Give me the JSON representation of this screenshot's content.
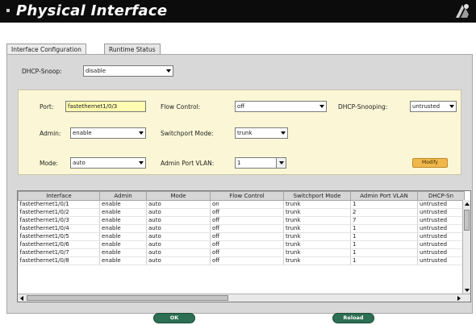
{
  "window": {
    "title": "Physical Interface"
  },
  "tabs": [
    {
      "label": "Interface Configuration",
      "active": true
    },
    {
      "label": "Runtime Status",
      "active": false
    }
  ],
  "dhcp_snoop": {
    "label": "DHCP-Snoop:",
    "value": "disable"
  },
  "config": {
    "port": {
      "label": "Port:",
      "value": "fastethernet1/0/3"
    },
    "flow_control": {
      "label": "Flow Control:",
      "value": "off"
    },
    "dhcp_snooping": {
      "label": "DHCP-Snooping:",
      "value": "untrusted"
    },
    "admin": {
      "label": "Admin:",
      "value": "enable"
    },
    "switchport_mode": {
      "label": "Switchport Mode:",
      "value": "trunk"
    },
    "mode": {
      "label": "Mode:",
      "value": "auto"
    },
    "admin_port_vlan": {
      "label": "Admin Port VLAN:",
      "value": "1"
    },
    "modify_label": "Modify"
  },
  "table": {
    "columns": [
      "Interface",
      "Admin",
      "Mode",
      "Flow Control",
      "Switchport Mode",
      "Admin Port VLAN",
      "DHCP-Sn"
    ],
    "rows": [
      [
        "fastethernet1/0/1",
        "enable",
        "auto",
        "on",
        "trunk",
        "1",
        "untrusted"
      ],
      [
        "fastethernet1/0/2",
        "enable",
        "auto",
        "off",
        "trunk",
        "2",
        "untrusted"
      ],
      [
        "fastethernet1/0/3",
        "enable",
        "auto",
        "off",
        "trunk",
        "7",
        "untrusted"
      ],
      [
        "fastethernet1/0/4",
        "enable",
        "auto",
        "off",
        "trunk",
        "1",
        "untrusted"
      ],
      [
        "fastethernet1/0/5",
        "enable",
        "auto",
        "off",
        "trunk",
        "1",
        "untrusted"
      ],
      [
        "fastethernet1/0/6",
        "enable",
        "auto",
        "off",
        "trunk",
        "1",
        "untrusted"
      ],
      [
        "fastethernet1/0/7",
        "enable",
        "auto",
        "off",
        "trunk",
        "1",
        "untrusted"
      ],
      [
        "fastethernet1/0/8",
        "enable",
        "auto",
        "off",
        "trunk",
        "1",
        "untrusted"
      ]
    ]
  },
  "buttons": {
    "ok": "OK",
    "reload": "Reload"
  },
  "colors": {
    "title_bar": "#0c0c0c",
    "panel": "#d8d8d8",
    "config_box": "#fbf7d6",
    "port_field": "#fffbb0",
    "modify_button": "#f0b84a",
    "action_button": "#2d6f52"
  },
  "icons": {
    "window_logo": "logo-icon",
    "dropdown": "chevron-down-icon"
  }
}
